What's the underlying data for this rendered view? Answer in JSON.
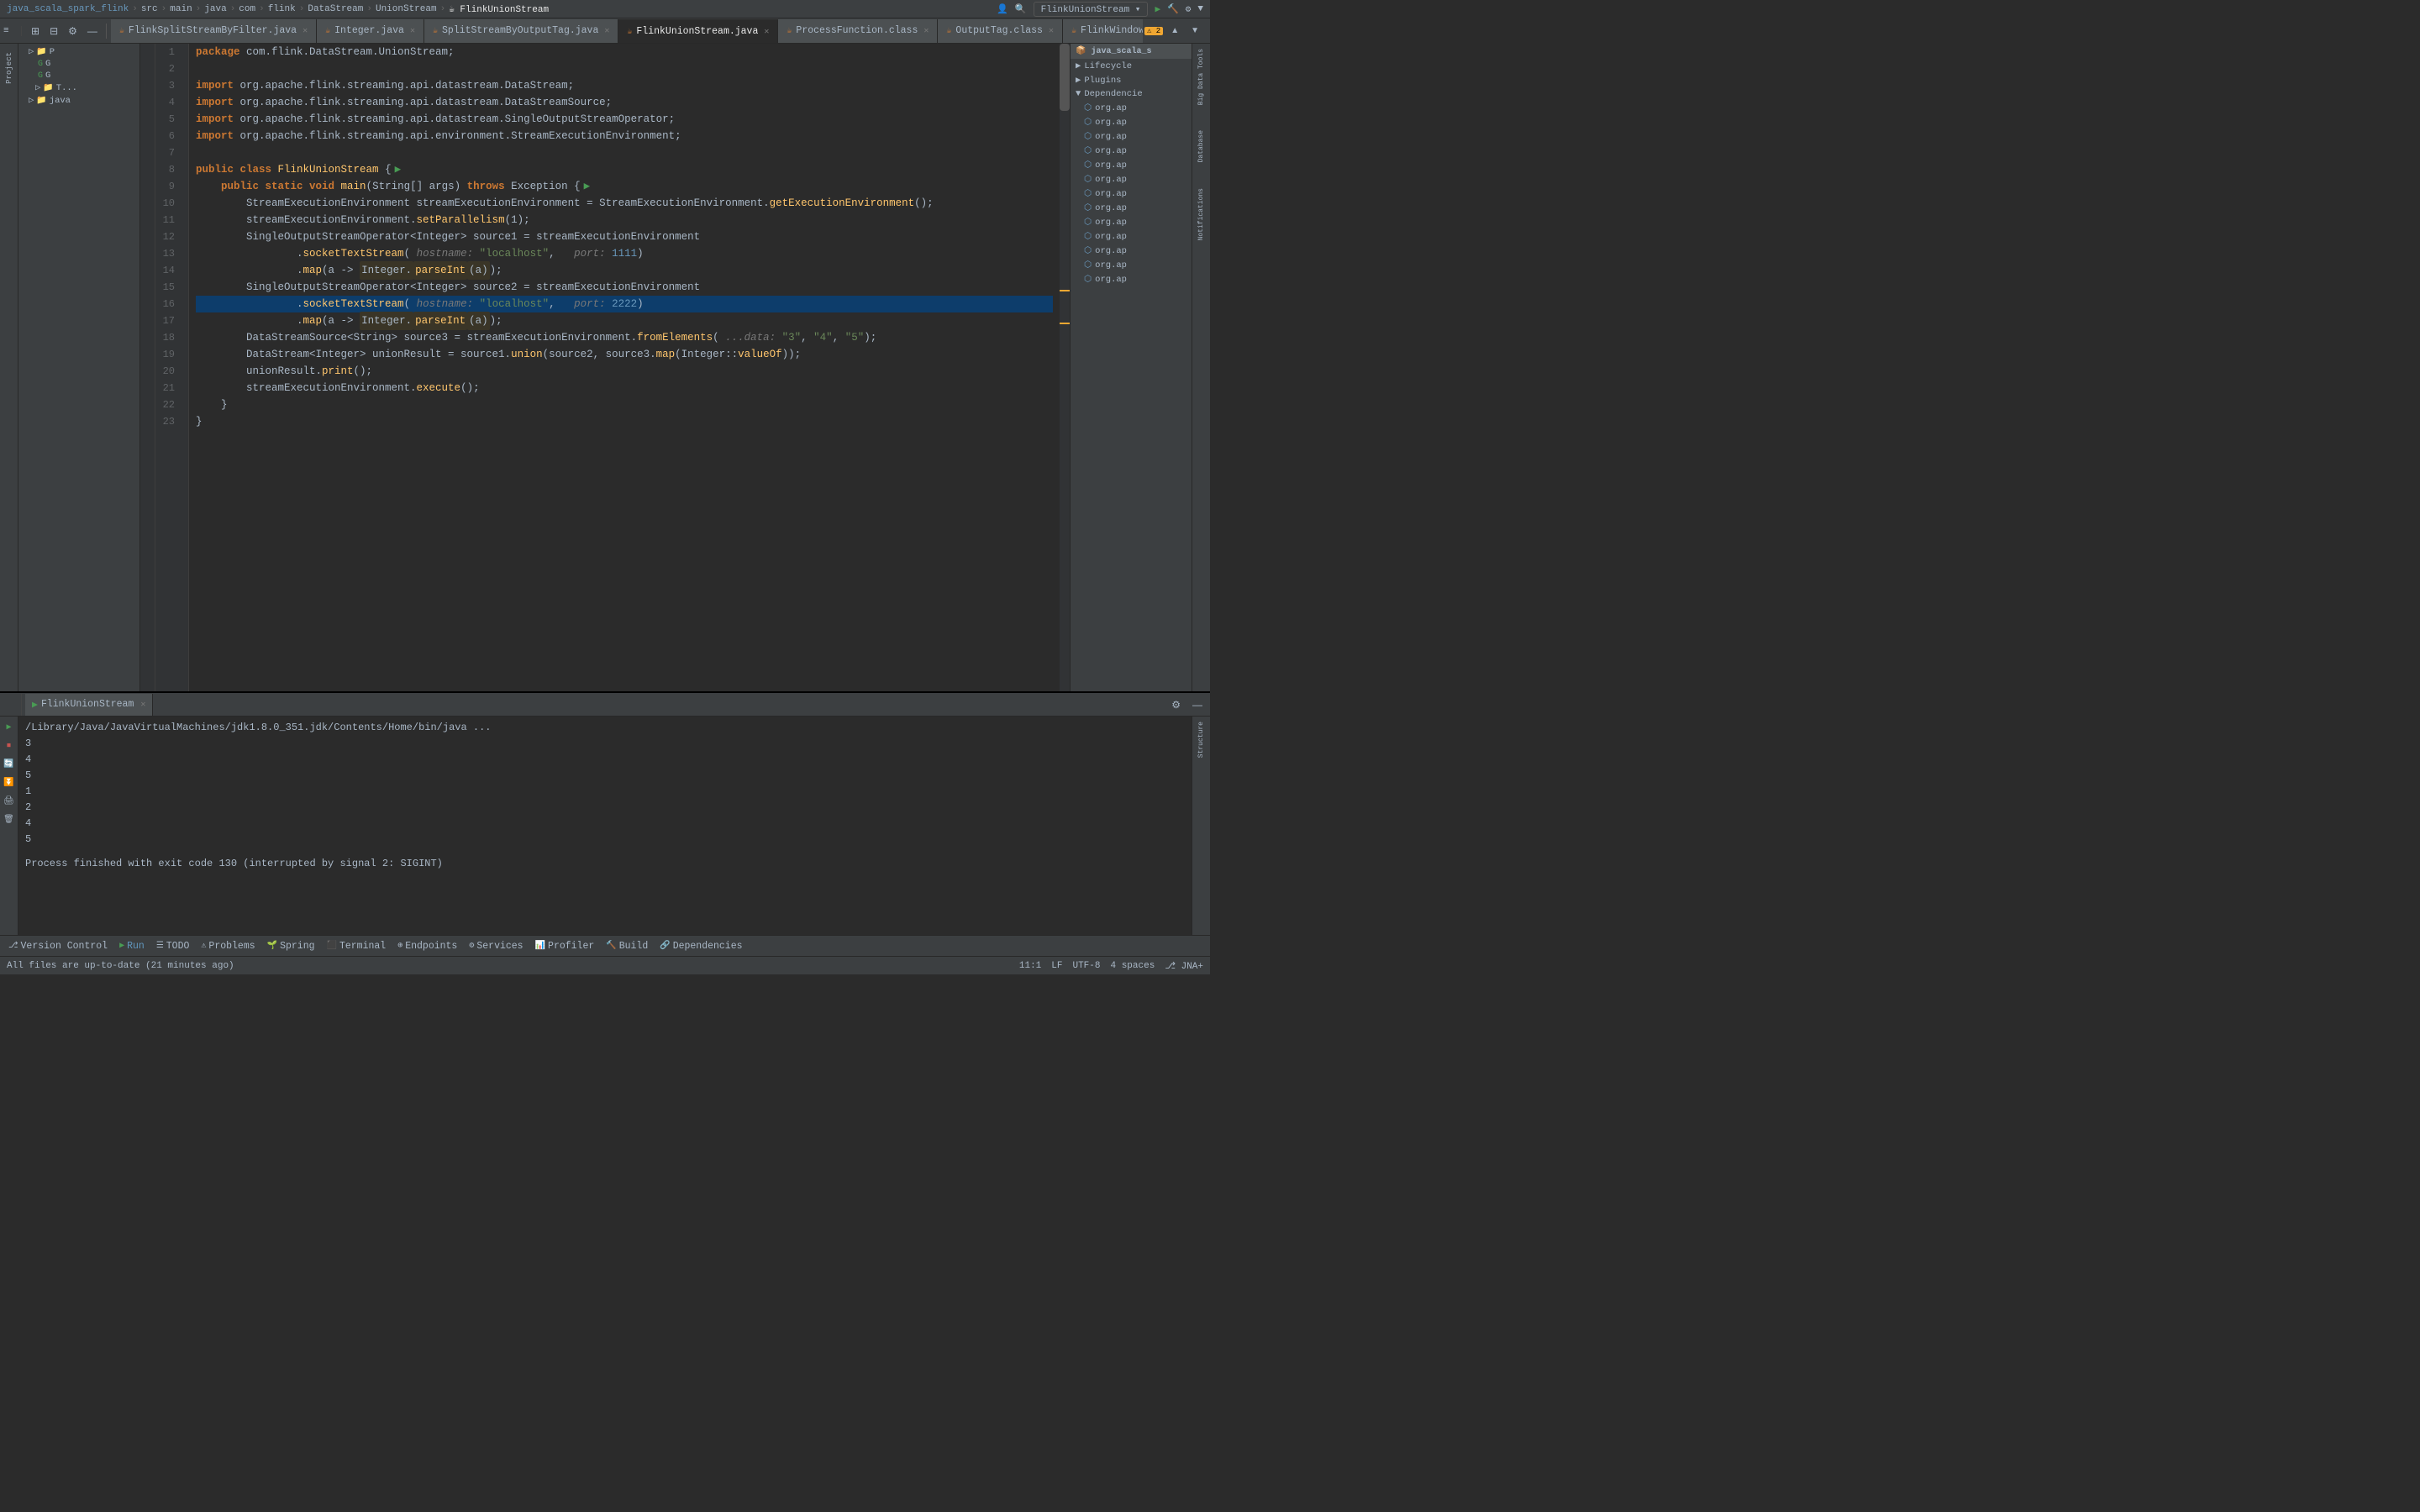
{
  "breadcrumb": {
    "items": [
      "java_scala_spark_flink",
      "src",
      "main",
      "java",
      "com",
      "flink",
      "DataStream",
      "UnionStream",
      "FlinkUnionStream"
    ]
  },
  "tabs": [
    {
      "label": "FlinkSplitStreamByFilter.java",
      "icon": "☕",
      "active": false,
      "modified": false
    },
    {
      "label": "Integer.java",
      "icon": "☕",
      "active": false,
      "modified": false
    },
    {
      "label": "SplitStreamByOutputTag.java",
      "icon": "☕",
      "active": false,
      "modified": false
    },
    {
      "label": "FlinkUnionStream.java",
      "icon": "☕",
      "active": true,
      "modified": false
    },
    {
      "label": "ProcessFunction.class",
      "icon": "☕",
      "active": false,
      "modified": false
    },
    {
      "label": "OutputTag.class",
      "icon": "☕",
      "active": false,
      "modified": false
    },
    {
      "label": "FlinkWindowTest",
      "icon": "☕",
      "active": false,
      "modified": false
    }
  ],
  "run_tab": "FlinkUnionStream",
  "console_output": {
    "command": "/Library/Java/JavaVirtualMachines/jdk1.8.0_351.jdk/Contents/Home/bin/java ...",
    "lines": [
      "3",
      "4",
      "5",
      "1",
      "2",
      "4",
      "5"
    ],
    "finish_msg": "Process finished with exit code 130 (interrupted by signal 2: SIGINT)"
  },
  "status_bar": {
    "version_control": "Version Control",
    "run_label": "Run",
    "todo": "TODO",
    "problems": "Problems",
    "spring": "Spring",
    "terminal": "Terminal",
    "endpoints": "Endpoints",
    "services": "Services",
    "profiler": "Profiler",
    "build": "Build",
    "dependencies": "Dependencies",
    "position": "11:1",
    "line_ending": "LF",
    "encoding": "UTF-8",
    "indent": "4 spaces",
    "git": "⎇ JNA+",
    "all_files": "All files are up-to-date (21 minutes ago)"
  },
  "maven_panel": {
    "title": "java_scala_s",
    "items": [
      "Lifecycle",
      "Plugins",
      "Dependenci",
      "org.ap",
      "org.ap",
      "org.ap",
      "org.ap",
      "org.ap",
      "org.ap",
      "org.ap",
      "org.ap",
      "org.ap",
      "org.ap",
      "org.ap",
      "org.ap",
      "org.ap"
    ]
  },
  "right_tools": [
    "Big Data Tools",
    "Database",
    "Notifications"
  ],
  "sidebar_items": [
    {
      "label": "P",
      "indent": 1,
      "type": "folder"
    },
    {
      "label": "G",
      "indent": 2,
      "type": "file"
    },
    {
      "label": "G",
      "indent": 2,
      "type": "file"
    },
    {
      "label": "T...",
      "indent": 2,
      "type": "folder"
    },
    {
      "label": "java",
      "indent": 1,
      "type": "folder"
    }
  ]
}
